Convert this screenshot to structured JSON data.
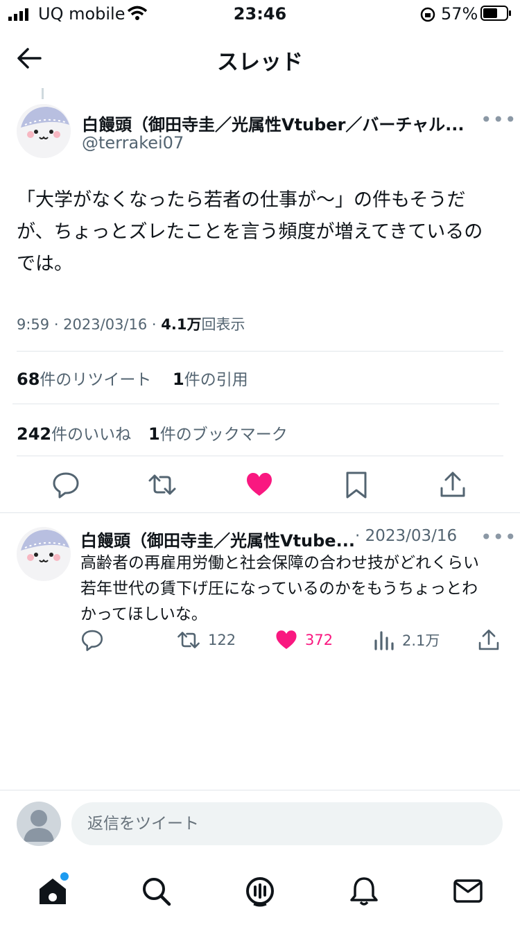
{
  "status_bar": {
    "carrier": "UQ mobile",
    "time": "23:46",
    "battery_percent": "57%"
  },
  "header": {
    "title": "スレッド"
  },
  "tweet": {
    "author_name": "白饅頭（御田寺圭／光属性Vtuber／バーチャル...",
    "handle": "@terrakei07",
    "text_lines": [
      "「大学がなくなったら若者の仕事が〜」の件もそうだ",
      "が、ちょっとズレたことを言う頻度が増えてきているの",
      "では。"
    ],
    "time": "9:59 · 2023/03/16 · ",
    "views_count": "4.1万",
    "views_label": "回表示",
    "retweets_count": "68",
    "retweets_label": "件のリツイート",
    "quotes_count": "1",
    "quotes_label": "件の引用",
    "likes_count": "242",
    "likes_label": "件のいいね",
    "bookmarks_count": "1",
    "bookmarks_label": "件のブックマーク",
    "liked": true
  },
  "reply": {
    "author_name": "白饅頭（御田寺圭／光属性Vtube...",
    "date": "· 2023/03/16",
    "text_lines": [
      "高齢者の再雇用労働と社会保障の合わせ技がどれくらい",
      "若年世代の賃下げ圧になっているのかをもうちょっとわ",
      "かってほしいな。"
    ],
    "retweets": "122",
    "likes": "372",
    "views": "2.1万"
  },
  "compose": {
    "placeholder": "返信をツイート"
  },
  "colors": {
    "like": "#f91880",
    "text": "#0f1419",
    "muted": "#536471",
    "badge": "#1d9bf0"
  },
  "icons": [
    "back-arrow-icon",
    "reply-icon",
    "retweet-icon",
    "like-icon",
    "bookmark-icon",
    "share-icon",
    "views-icon",
    "home-icon",
    "search-icon",
    "spaces-icon",
    "notifications-icon",
    "messages-icon"
  ]
}
